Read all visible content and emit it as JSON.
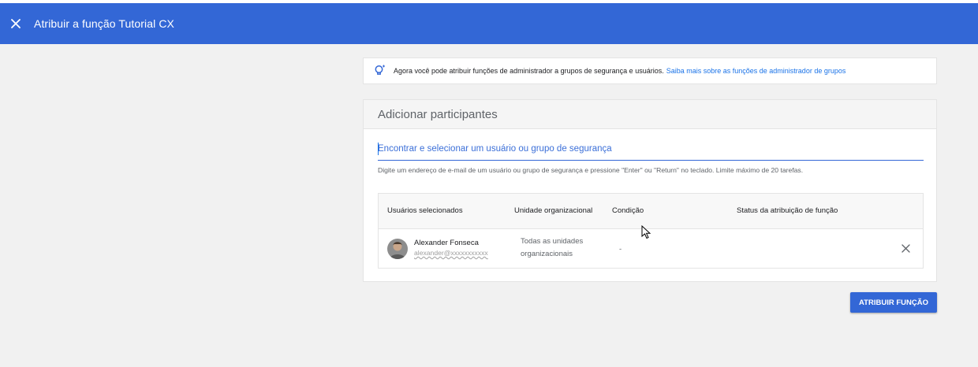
{
  "header": {
    "title": "Atribuir a função Tutorial CX",
    "close_icon": "close-icon",
    "color": "#3367d6"
  },
  "info": {
    "icon": "lightbulb-icon",
    "text": "Agora você pode atribuir funções de administrador a grupos de segurança e usuários.",
    "link": "Saiba mais sobre as funções de administrador de grupos"
  },
  "participants": {
    "title": "Adicionar participantes",
    "search_placeholder": "Encontrar e selecionar um usuário ou grupo de segurança",
    "hint": "Digite um endereço de e-mail de um usuário ou grupo de segurança e pressione \"Enter\" ou \"Return\" no teclado. Limite máximo de 20 tarefas.",
    "columns": [
      "Usuários selecionados",
      "Unidade organizacional",
      "Condição",
      "Status da atribuição de função"
    ],
    "rows": [
      {
        "name": "Alexander Fonseca",
        "email": "alexander@xxxxxxxxxxx",
        "org_unit": "Todas as unidades organizacionais",
        "condition": "-",
        "status": ""
      }
    ]
  },
  "actions": {
    "assign_label": "ATRIBUIR FUNÇÃO"
  }
}
